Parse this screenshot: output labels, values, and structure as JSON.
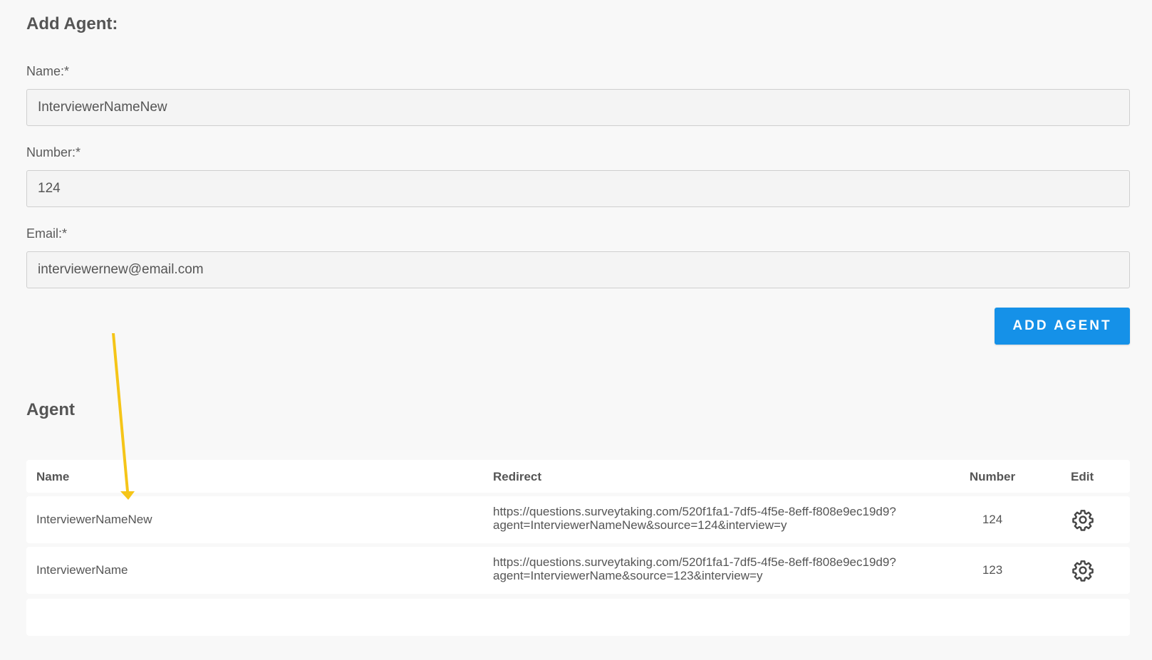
{
  "form": {
    "title": "Add Agent:",
    "name_label": "Name:*",
    "name_value": "InterviewerNameNew",
    "number_label": "Number:*",
    "number_value": "124",
    "email_label": "Email:*",
    "email_value": "interviewernew@email.com",
    "submit_label": "ADD AGENT"
  },
  "agents": {
    "title": "Agent",
    "columns": {
      "name": "Name",
      "redirect": "Redirect",
      "number": "Number",
      "edit": "Edit"
    },
    "rows": [
      {
        "name": "InterviewerNameNew",
        "redirect_line1": "https://questions.surveytaking.com/520f1fa1-7df5-4f5e-8eff-f808e9ec19d9?",
        "redirect_line2": "agent=InterviewerNameNew&source=124&interview=y",
        "number": "124",
        "edit_icon": "gear-icon"
      },
      {
        "name": "InterviewerName",
        "redirect_line1": "https://questions.surveytaking.com/520f1fa1-7df5-4f5e-8eff-f808e9ec19d9?",
        "redirect_line2": "agent=InterviewerName&source=123&interview=y",
        "number": "123",
        "edit_icon": "gear-icon"
      }
    ]
  },
  "colors": {
    "background": "#f8f8f8",
    "accent": "#1591e8",
    "annotation_arrow": "#f5c518"
  }
}
